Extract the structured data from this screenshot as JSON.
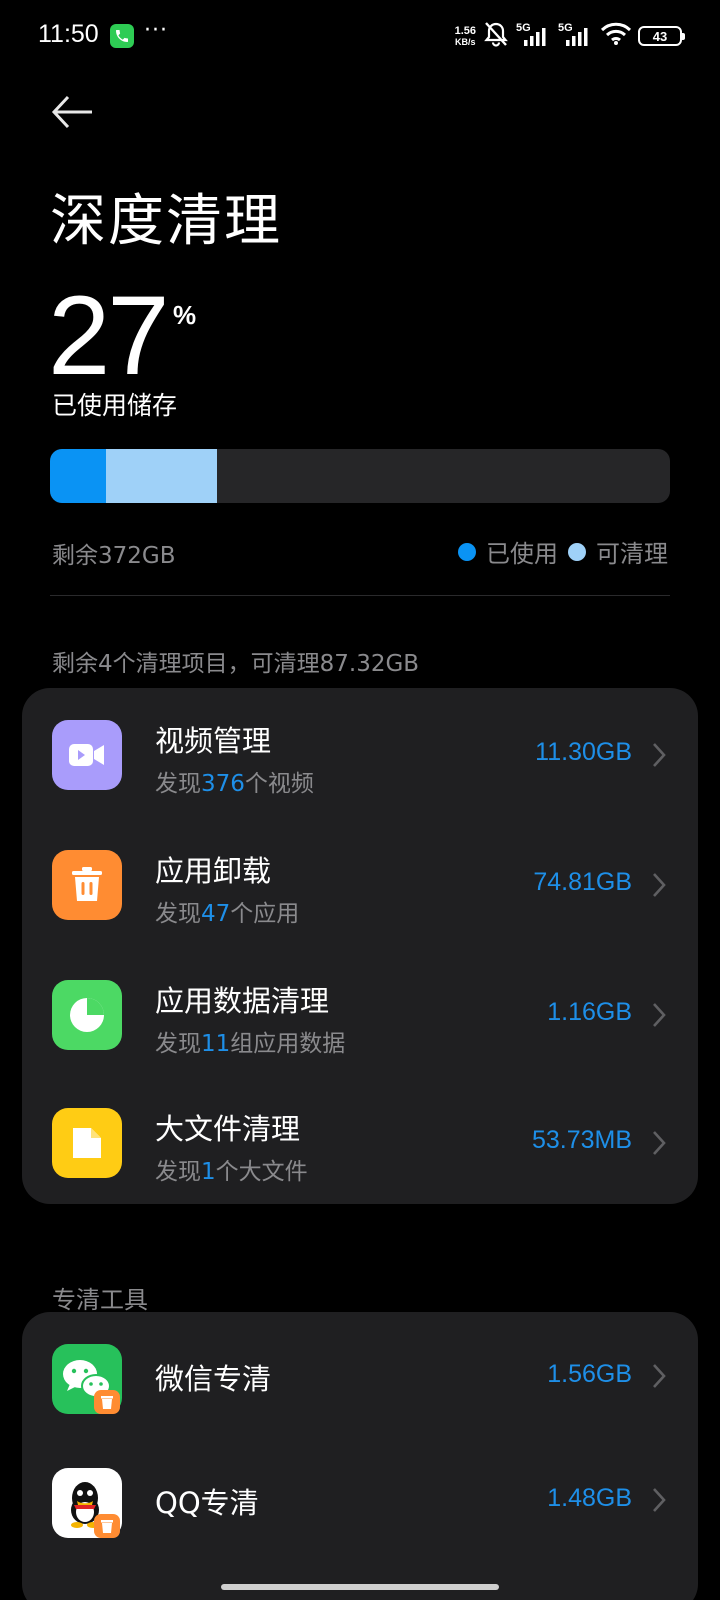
{
  "status_bar": {
    "time": "11:50",
    "dots": "···",
    "speed_value": "1.56",
    "speed_unit": "KB/s",
    "sim1": "5G",
    "sim2": "5G",
    "battery": "43"
  },
  "page": {
    "title": "深度清理"
  },
  "storage": {
    "used_percent": "27",
    "percent_sign": "%",
    "used_label": "已使用储存",
    "used_fraction": 0.09,
    "cleanable_fraction": 0.18,
    "remaining": "剩余372GB",
    "legend_used": "已使用",
    "legend_cleanable": "可清理",
    "color_used": "#0a93f4",
    "color_cleanable": "#9fd1f8"
  },
  "summary": "剩余4个清理项目，可清理87.32GB",
  "items": [
    {
      "name": "视频管理",
      "sub_prefix": "发现",
      "sub_count": "376",
      "sub_suffix": "个视频",
      "size": "11.30GB",
      "icon": "video-icon"
    },
    {
      "name": "应用卸载",
      "sub_prefix": "发现",
      "sub_count": "47",
      "sub_suffix": "个应用",
      "size": "74.81GB",
      "icon": "trash-icon"
    },
    {
      "name": "应用数据清理",
      "sub_prefix": "发现",
      "sub_count": "11",
      "sub_suffix": "组应用数据",
      "size": "1.16GB",
      "icon": "pie-chart-icon"
    },
    {
      "name": "大文件清理",
      "sub_prefix": "发现",
      "sub_count": "1",
      "sub_suffix": "个大文件",
      "size": "53.73MB",
      "icon": "folder-icon"
    }
  ],
  "tools_section": "专清工具",
  "tools": [
    {
      "name": "微信专清",
      "size": "1.56GB",
      "icon": "wechat-icon"
    },
    {
      "name": "QQ专清",
      "size": "1.48GB",
      "icon": "qq-icon"
    }
  ]
}
